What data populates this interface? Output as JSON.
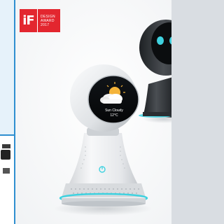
{
  "award": {
    "logo": "iF",
    "line1": "DESIGN",
    "line2": "AWARD",
    "year": "2017",
    "color": "#e3262f"
  },
  "screen": {
    "weather_icon": "sun-behind-cloud-icon",
    "description": "Sun Cloudy",
    "temperature": "12°C"
  },
  "colors": {
    "frame_border": "#2f8fd0",
    "device_body": "#e9ebee",
    "device_dark": "#2e3135",
    "accent_ring": "#3fd2e0"
  }
}
